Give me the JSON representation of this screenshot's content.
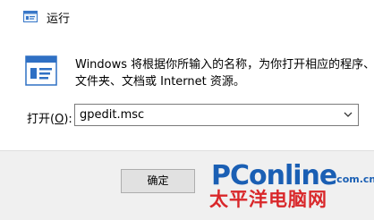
{
  "titlebar": {
    "title": "运行",
    "icon": "run-app-icon"
  },
  "content": {
    "icon": "run-app-icon",
    "description_line1": "Windows 将根据你所输入的名称，为你打开相应的程序、",
    "description_line2": "文件夹、文档或 Internet 资源。"
  },
  "open_field": {
    "label_prefix": "打开(",
    "label_hotkey": "O",
    "label_suffix": "):",
    "value": "gpedit.msc"
  },
  "buttons": {
    "ok_label": "确定"
  },
  "watermark": {
    "main": "PConline",
    "suffix": ".com.cn",
    "sub": "太平洋电脑网"
  },
  "colors": {
    "window_bg": "#ffffff",
    "footer_bg": "#f0f0f0",
    "watermark_blue": "#1a5fb4",
    "watermark_red": "#d9272a"
  }
}
